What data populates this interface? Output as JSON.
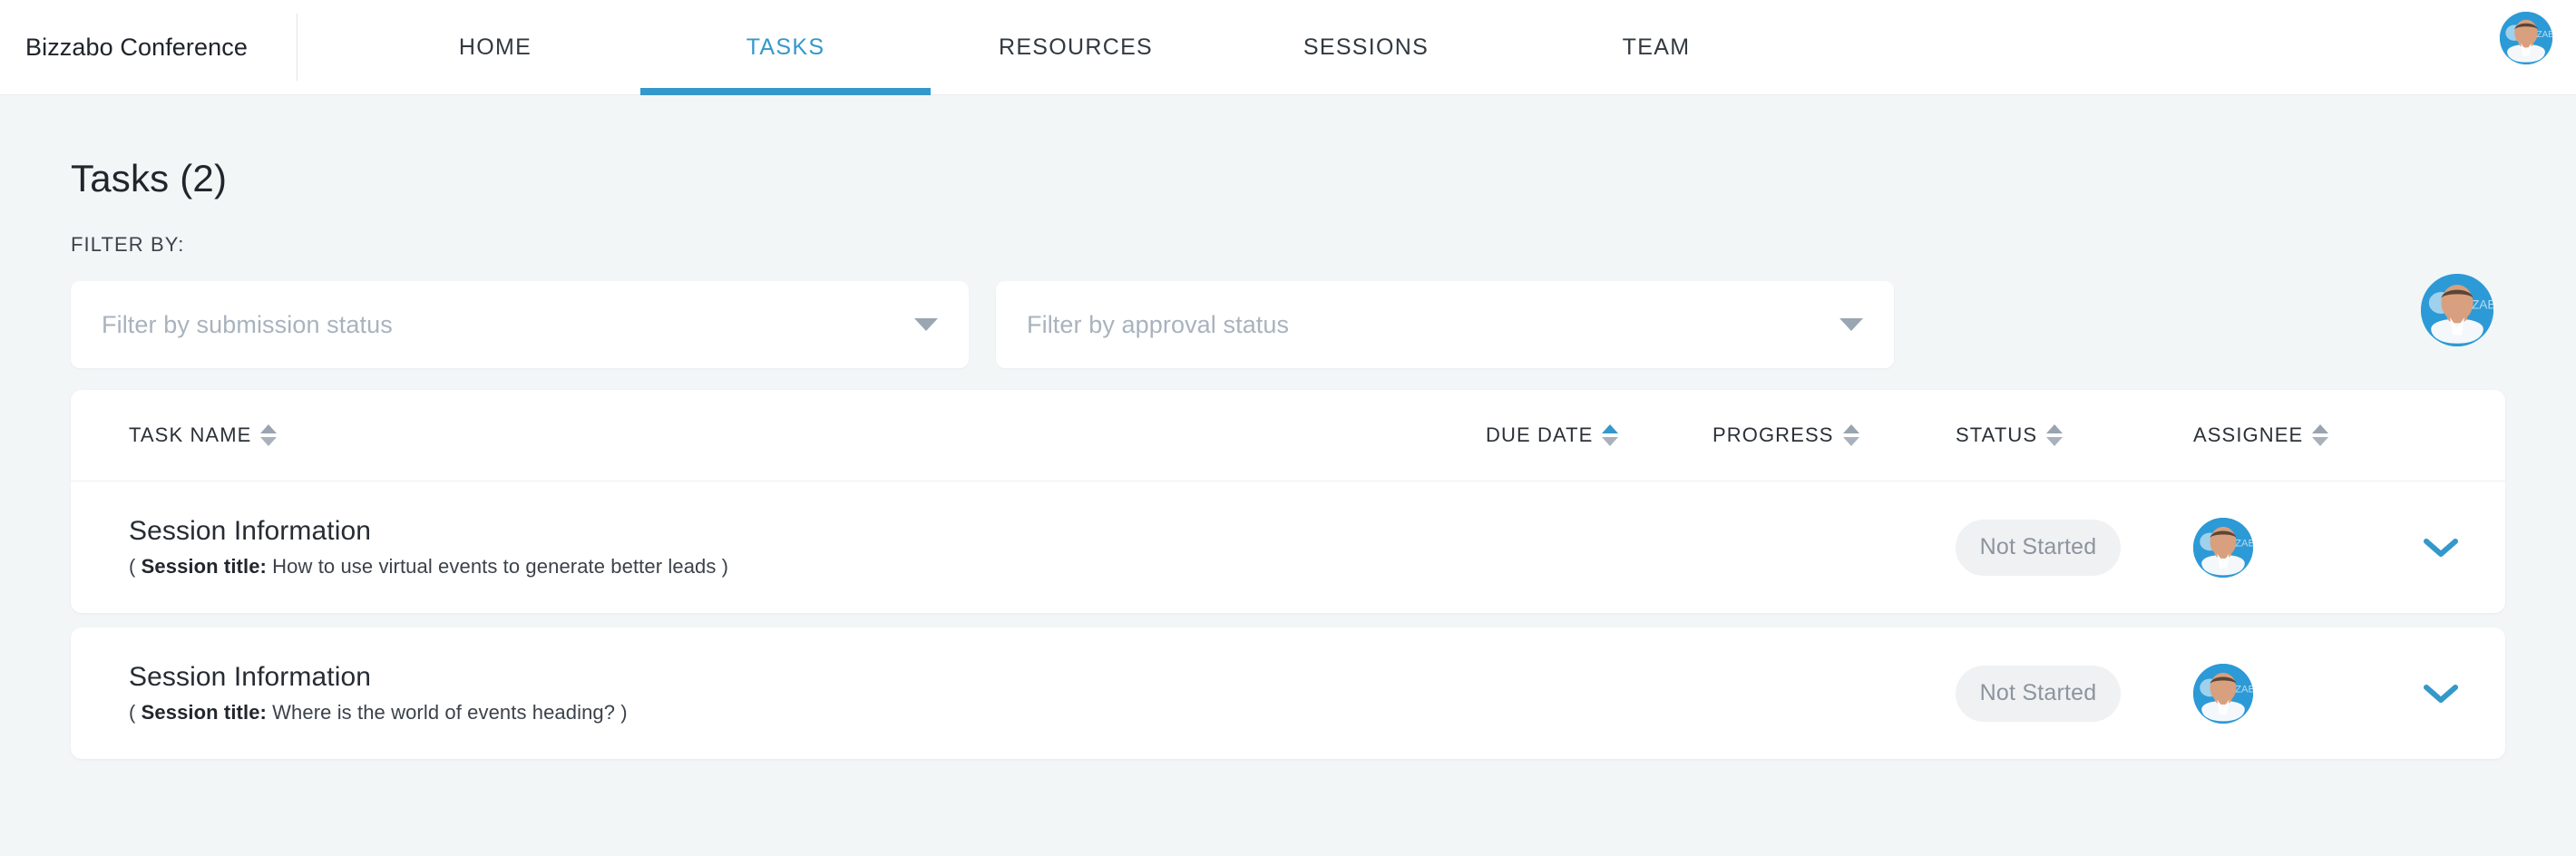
{
  "nav": {
    "brand": "Bizzabo Conference",
    "tabs": [
      {
        "label": "HOME",
        "active": false
      },
      {
        "label": "TASKS",
        "active": true
      },
      {
        "label": "RESOURCES",
        "active": false
      },
      {
        "label": "SESSIONS",
        "active": false
      },
      {
        "label": "TEAM",
        "active": false
      }
    ],
    "account_avatar": "user-avatar"
  },
  "page": {
    "title": "Tasks (2)",
    "filter_label": "FILTER BY:"
  },
  "filters": {
    "submission": {
      "placeholder": "Filter by submission status",
      "value": "",
      "icon": "chevron-down-icon"
    },
    "approval": {
      "placeholder": "Filter by approval status",
      "value": "",
      "icon": "chevron-down-icon"
    },
    "avatar": "user-avatar"
  },
  "table": {
    "columns": [
      {
        "label": "TASK NAME",
        "sorted": false
      },
      {
        "label": "DUE DATE",
        "sorted": true
      },
      {
        "label": "PROGRESS",
        "sorted": false
      },
      {
        "label": "STATUS",
        "sorted": false
      },
      {
        "label": "ASSIGNEE",
        "sorted": false
      }
    ],
    "rows": [
      {
        "name": "Session Information",
        "sub_prefix": "( ",
        "sub_label": "Session title:",
        "sub_value": " How to use virtual events to generate better leads )",
        "due_date": "",
        "progress": "",
        "status": "Not Started",
        "assignee": "user-avatar",
        "expand_icon": "chevron-down-icon"
      },
      {
        "name": "Session Information",
        "sub_prefix": "( ",
        "sub_label": "Session title:",
        "sub_value": " Where is the world of events heading? )",
        "due_date": "",
        "progress": "",
        "status": "Not Started",
        "assignee": "user-avatar",
        "expand_icon": "chevron-down-icon"
      }
    ]
  },
  "colors": {
    "accent": "#3498ca",
    "page_bg": "#f2f6f7",
    "card_bg": "#ffffff",
    "badge_bg": "#f0f1f3",
    "badge_text": "#8c949e",
    "text_primary": "#22262c",
    "placeholder": "#a8b3be"
  }
}
